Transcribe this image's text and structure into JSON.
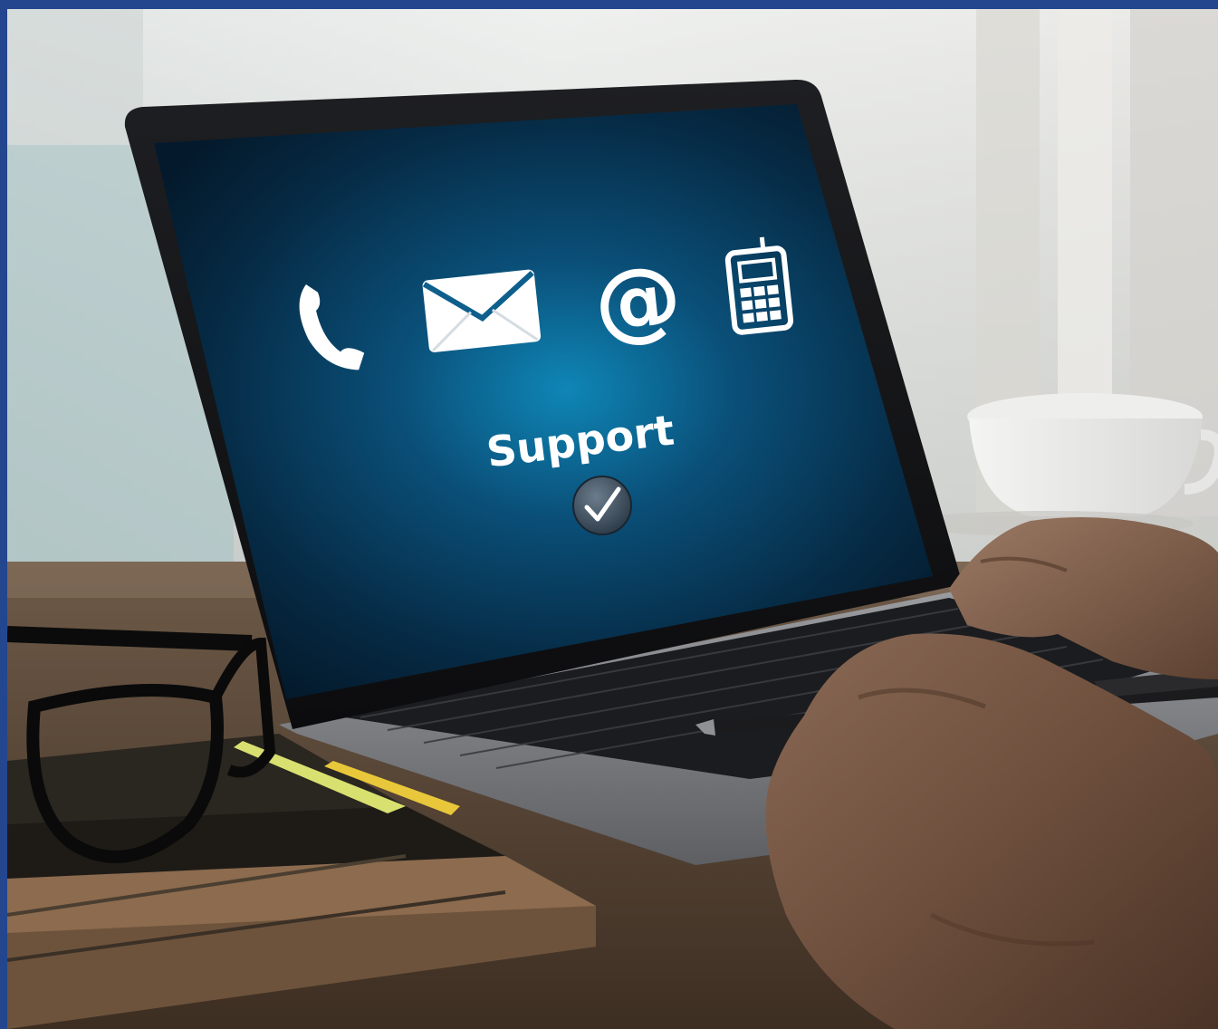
{
  "photo": {
    "description_subject": "laptop-support-screen",
    "border_color": "#23468f"
  },
  "screen": {
    "label": "Support",
    "icons": [
      "phone-icon",
      "envelope-icon",
      "at-sign-icon",
      "mobile-phone-icon",
      "checkmark-icon"
    ],
    "accent": "#0e7fae"
  }
}
